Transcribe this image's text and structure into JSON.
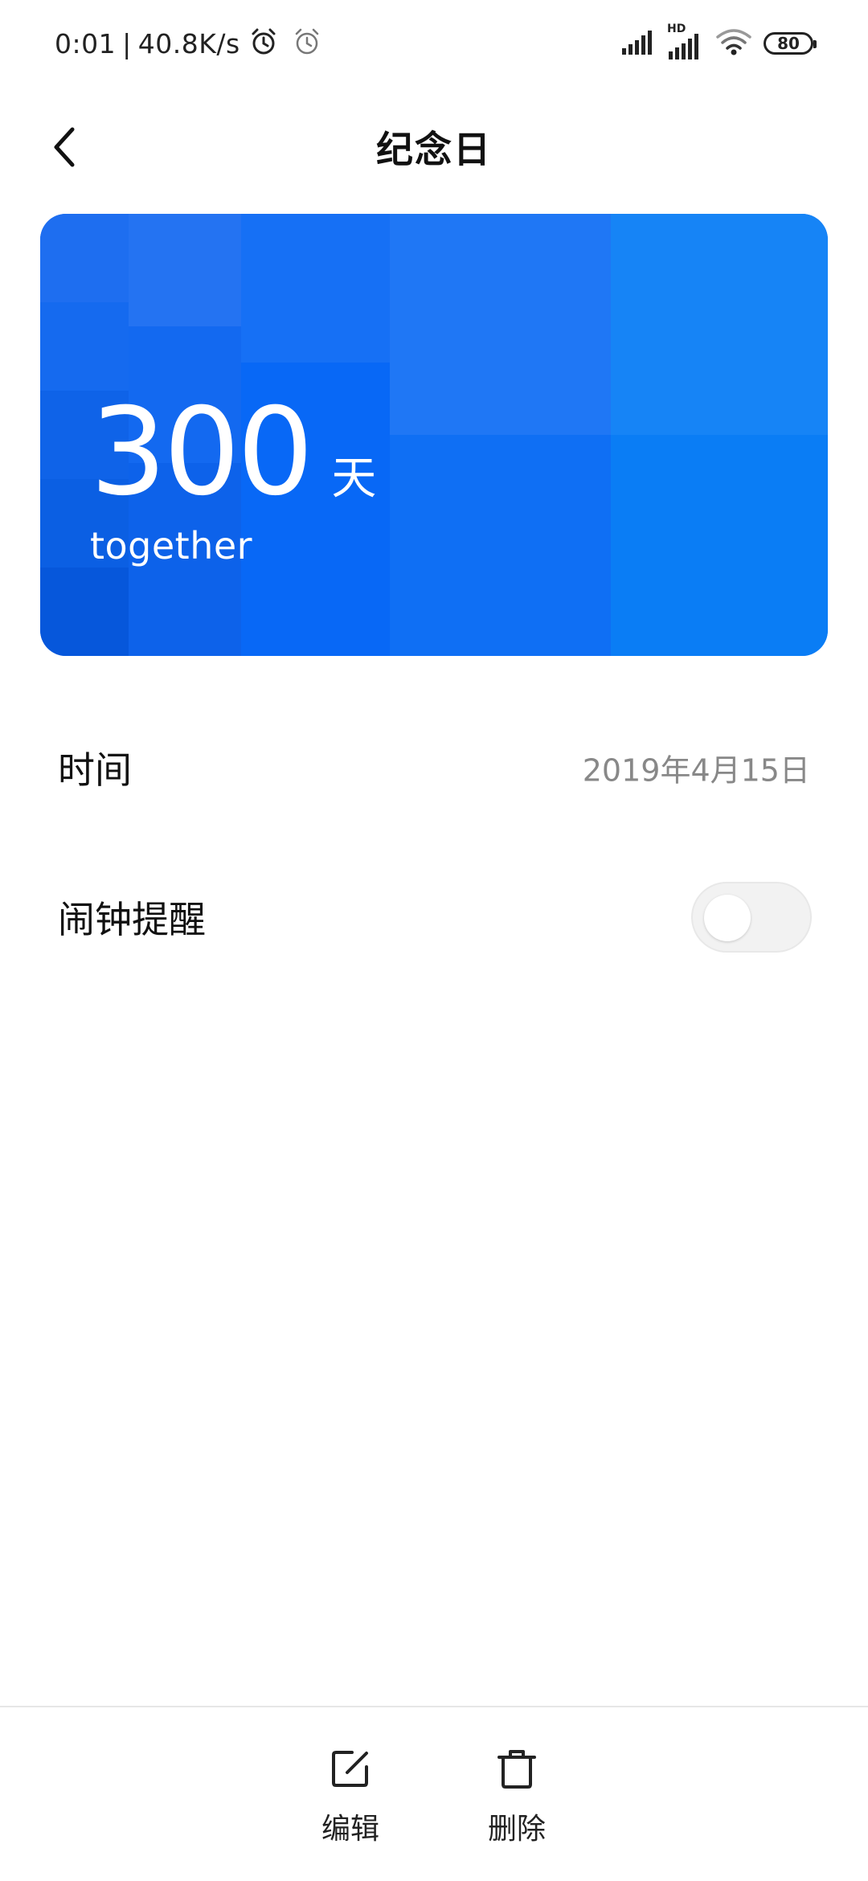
{
  "status_bar": {
    "time": "0:01",
    "separator": "|",
    "net_speed": "40.8K/s",
    "battery": "80",
    "network_badge": "HD",
    "icons": [
      "alarm-icon",
      "alarm-outline-icon",
      "signal-icon",
      "hd-signal-icon",
      "wifi-icon",
      "battery-icon"
    ]
  },
  "header": {
    "title": "纪念日",
    "back_icon": "back-arrow-icon"
  },
  "card": {
    "count": "300",
    "unit": "天",
    "subtitle": "together",
    "color": "#1a6ff2"
  },
  "rows": {
    "time": {
      "label": "时间",
      "value": "2019年4月15日"
    },
    "alarm": {
      "label": "闹钟提醒",
      "enabled": false
    }
  },
  "actions": {
    "edit": {
      "label": "编辑",
      "icon": "edit-icon"
    },
    "delete": {
      "label": "删除",
      "icon": "trash-icon"
    }
  }
}
